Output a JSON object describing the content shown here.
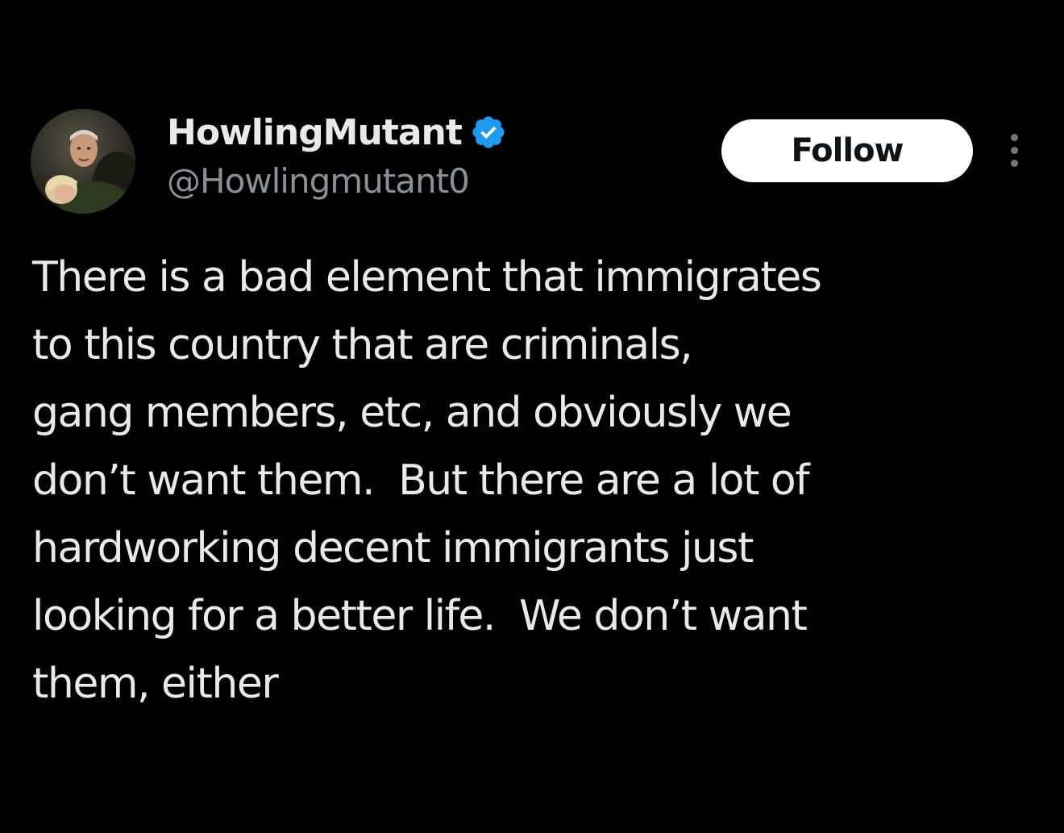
{
  "tweet": {
    "author": {
      "display_name": "HowlingMutant",
      "handle": "@Howlingmutant0",
      "verified": true,
      "avatar_icon": "profile-photo-man-holding-child"
    },
    "follow_button_label": "Follow",
    "more_icon": "more-options-ellipsis",
    "text_lines": [
      "There is a bad element that immigrates",
      "to this country that are criminals,",
      "gang members, etc, and obviously we",
      "don’t want them.  But there are a lot of",
      "hardworking decent immigrants just",
      "looking for a better life.  We don’t want",
      "them, either"
    ]
  },
  "colors": {
    "background": "#000000",
    "primary_text": "#e7e9ea",
    "secondary_text": "#8b9097",
    "verified_badge": "#1d9bf0",
    "follow_button_bg": "#ffffff",
    "follow_button_text": "#0f1419"
  }
}
